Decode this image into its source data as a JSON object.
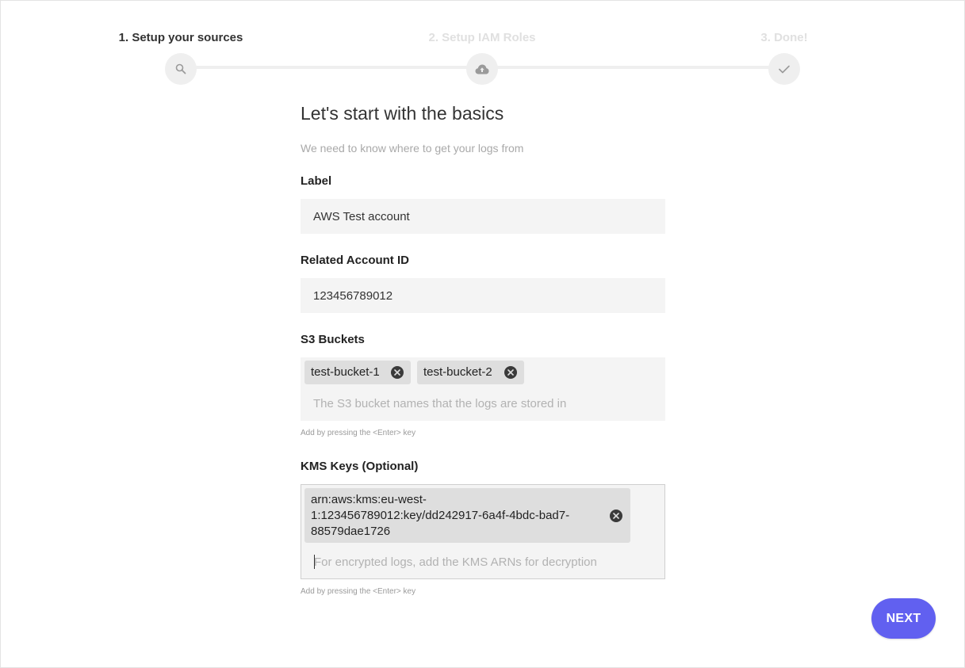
{
  "stepper": {
    "steps": [
      {
        "label": "1. Setup your sources",
        "state": "active",
        "icon": "search-icon"
      },
      {
        "label": "2. Setup IAM Roles",
        "state": "inactive",
        "icon": "cloud-upload-icon"
      },
      {
        "label": "3. Done!",
        "state": "inactive",
        "icon": "check-icon"
      }
    ]
  },
  "form": {
    "heading": "Let's start with the basics",
    "subheading": "We need to know where to get your logs from",
    "label_field": {
      "label": "Label",
      "value": "AWS Test account"
    },
    "account_id_field": {
      "label": "Related Account ID",
      "value": "123456789012"
    },
    "s3_buckets_field": {
      "label": "S3 Buckets",
      "chips": [
        "test-bucket-1",
        "test-bucket-2"
      ],
      "placeholder": "The S3 bucket names that the logs are stored in",
      "hint": "Add by pressing the <Enter> key"
    },
    "kms_keys_field": {
      "label": "KMS Keys (Optional)",
      "chips": [
        {
          "line1": "arn:aws:kms:eu-west-",
          "line2": "1:123456789012:key/dd242917-6a4f-4bdc-bad7-",
          "line3": "88579dae1726"
        }
      ],
      "placeholder": "For encrypted logs, add the KMS ARNs for decryption",
      "hint": "Add by pressing the <Enter> key"
    }
  },
  "actions": {
    "next_label": "NEXT"
  },
  "colors": {
    "accent": "#6160f0",
    "input_bg": "#f4f4f4",
    "chip_bg": "#dedede",
    "step_track": "#efefef"
  }
}
